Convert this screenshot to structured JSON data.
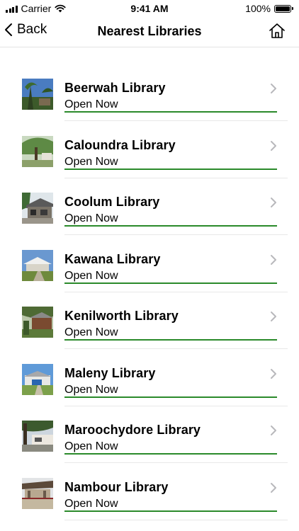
{
  "status_bar": {
    "carrier": "Carrier",
    "time": "9:41 AM",
    "battery": "100%"
  },
  "nav": {
    "back_label": "Back",
    "title": "Nearest Libraries",
    "home_icon": "home-icon"
  },
  "colors": {
    "status_line": "#2a8a2a",
    "chevron": "#b8b8bc",
    "separator": "#e8e8e8"
  },
  "libraries": [
    {
      "name": "Beerwah Library",
      "status": "Open Now"
    },
    {
      "name": "Caloundra Library",
      "status": "Open Now"
    },
    {
      "name": "Coolum Library",
      "status": "Open Now"
    },
    {
      "name": "Kawana Library",
      "status": "Open Now"
    },
    {
      "name": "Kenilworth Library",
      "status": "Open Now"
    },
    {
      "name": "Maleny Library",
      "status": "Open Now"
    },
    {
      "name": "Maroochydore Library",
      "status": "Open Now"
    },
    {
      "name": "Nambour Library",
      "status": "Open Now"
    }
  ]
}
